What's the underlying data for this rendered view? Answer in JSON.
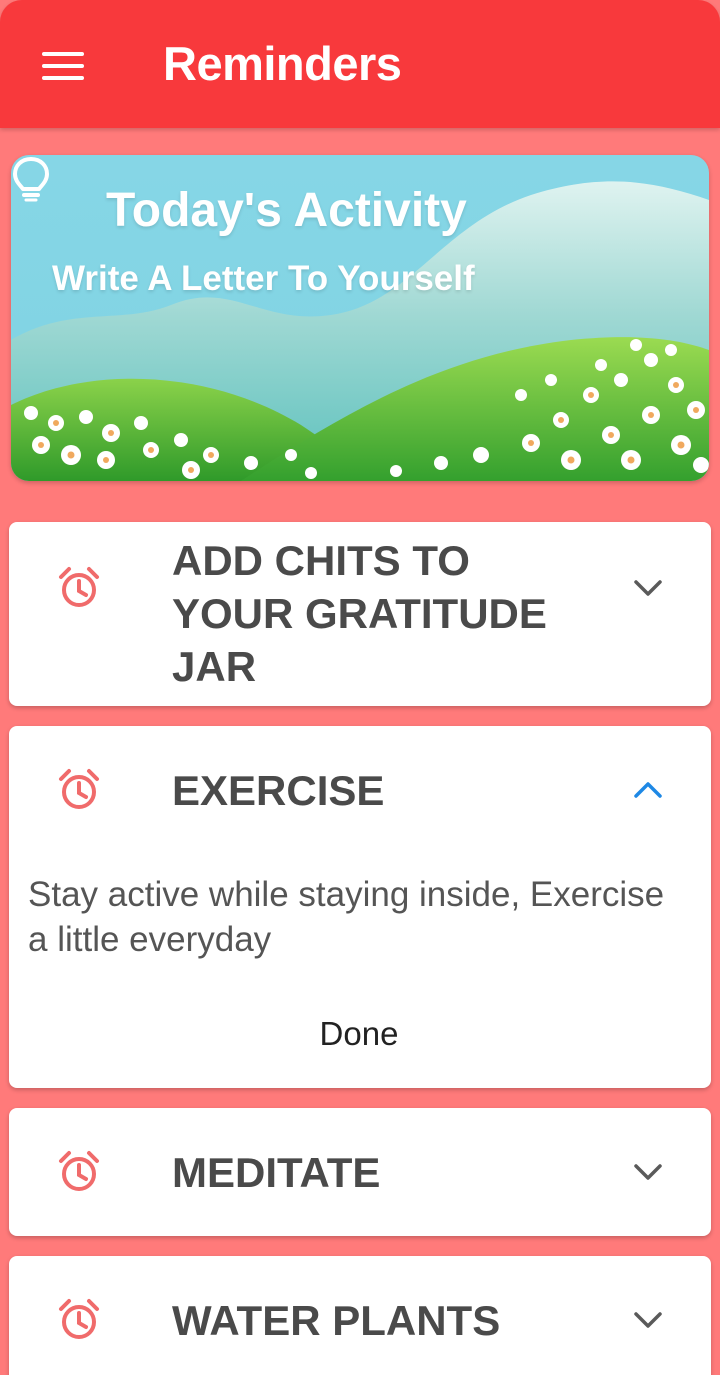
{
  "appbar": {
    "title": "Reminders"
  },
  "banner": {
    "title": "Today's Activity",
    "subtitle": "Write A Letter To Yourself"
  },
  "reminders": [
    {
      "title": "ADD CHITS TO YOUR GRATITUDE JAR",
      "expanded": false
    },
    {
      "title": "EXERCISE",
      "expanded": true,
      "description": "Stay active while staying inside, Exercise a little everyday",
      "action": "Done"
    },
    {
      "title": "MEDITATE",
      "expanded": false
    },
    {
      "title": "WATER PLANTS",
      "expanded": false
    }
  ],
  "colors": {
    "appbar": "#f8393c",
    "background": "#ff7a7a",
    "icon": "#f06b6b",
    "expanded_chevron": "#1e88e5",
    "collapsed_chevron": "#5a5a5a"
  },
  "icons": {
    "menu": "menu-icon",
    "banner": "lightbulb-icon",
    "reminder": "alarm-clock-icon",
    "collapsed": "chevron-down-icon",
    "expanded": "chevron-up-icon"
  }
}
